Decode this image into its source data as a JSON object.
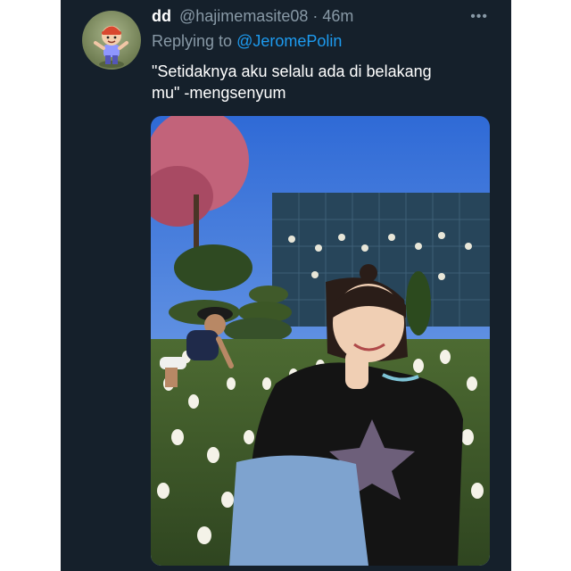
{
  "tweet": {
    "display_name": "dd",
    "handle": "@hajimemasite08",
    "separator": "·",
    "time": "46m",
    "replying_prefix": "Replying to",
    "replying_to": "@JeromePolin",
    "text": "\"Setidaknya aku selalu ada di belakang mu\" -mengsenyum",
    "more_icon": "more-horizontal-icon"
  },
  "colors": {
    "background": "#15202b",
    "accent": "#1d9bf0",
    "secondary_text": "#8899a6"
  }
}
